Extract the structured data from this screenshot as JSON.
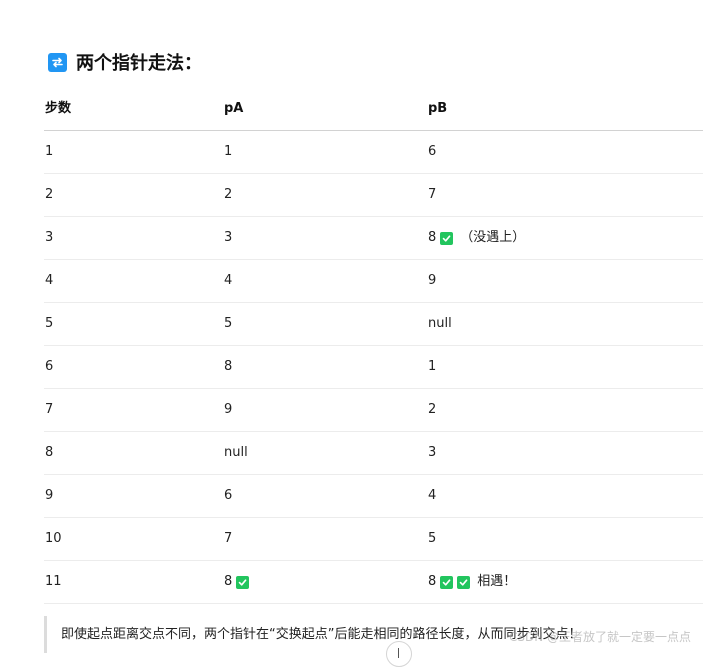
{
  "heading": {
    "title": "两个指针走法：",
    "icon": "swap-icon",
    "icon_color": "#2196f3"
  },
  "table": {
    "headers": [
      "步数",
      "pA",
      "pB"
    ],
    "check_color": "#22c55e",
    "rows": [
      {
        "step": "1",
        "pA": "1",
        "pB": "6"
      },
      {
        "step": "2",
        "pA": "2",
        "pB": "7"
      },
      {
        "step": "3",
        "pA": "3",
        "pB": "8",
        "pB_checks": 1,
        "pB_note": "（没遇上）"
      },
      {
        "step": "4",
        "pA": "4",
        "pB": "9"
      },
      {
        "step": "5",
        "pA": "5",
        "pB": "null"
      },
      {
        "step": "6",
        "pA": "8",
        "pB": "1"
      },
      {
        "step": "7",
        "pA": "9",
        "pB": "2"
      },
      {
        "step": "8",
        "pA": "null",
        "pB": "3"
      },
      {
        "step": "9",
        "pA": "6",
        "pB": "4"
      },
      {
        "step": "10",
        "pA": "7",
        "pB": "5"
      },
      {
        "step": "11",
        "pA": "8",
        "pA_checks": 1,
        "pB": "8",
        "pB_checks": 2,
        "pB_note": "相遇！"
      }
    ]
  },
  "quote": {
    "text": "即使起点距离交点不同，两个指针在“交换起点”后能走相同的路径长度，从而同步到交点！"
  },
  "watermark": {
    "text": "CSDN @王者放了就一定要一点点"
  }
}
